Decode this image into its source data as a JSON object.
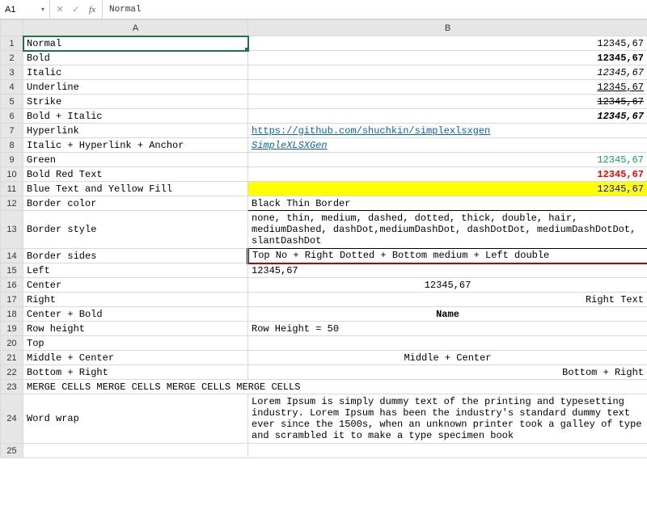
{
  "formula_bar": {
    "name_box": "A1",
    "formula_value": "Normal"
  },
  "col_headers": {
    "A": "A",
    "B": "B"
  },
  "rows": {
    "r1": {
      "a": "Normal",
      "b": "12345,67"
    },
    "r2": {
      "a": "Bold",
      "b": "12345,67"
    },
    "r3": {
      "a": "Italic",
      "b": "12345,67"
    },
    "r4": {
      "a": "Underline",
      "b": "12345,67"
    },
    "r5": {
      "a": "Strike",
      "b": "12345,67"
    },
    "r6": {
      "a": "Bold + Italic",
      "b": "12345,67"
    },
    "r7": {
      "a": "Hyperlink",
      "b": "https://github.com/shuchkin/simplexlsxgen"
    },
    "r8": {
      "a": "Italic + Hyperlink + Anchor",
      "b": "SimpleXLSXGen"
    },
    "r9": {
      "a": "Green",
      "b": "12345,67"
    },
    "r10": {
      "a": "Bold Red Text",
      "b": "12345,67"
    },
    "r11": {
      "a": "Blue Text and Yellow Fill",
      "b": "12345,67"
    },
    "r12": {
      "a": "Border color",
      "b": "Black Thin Border"
    },
    "r13": {
      "a": "Border style",
      "b": "none, thin, medium, dashed, dotted, thick, double, hair, mediumDashed, dashDot,mediumDashDot, dashDotDot, mediumDashDotDot, slantDashDot"
    },
    "r14": {
      "a": "Border sides",
      "b": "Top No + Right Dotted + Bottom medium + Left double"
    },
    "r15": {
      "a": "Left",
      "b": "12345,67"
    },
    "r16": {
      "a": "Center",
      "b": "12345,67"
    },
    "r17": {
      "a": "Right",
      "b": "Right Text"
    },
    "r18": {
      "a": "Center + Bold",
      "b": "Name"
    },
    "r19": {
      "a": "Row height",
      "b": "Row Height = 50"
    },
    "r20": {
      "a": "Top",
      "b": ""
    },
    "r21": {
      "a": "Middle + Center",
      "b": "Middle + Center"
    },
    "r22": {
      "a": "Bottom + Right",
      "b": "Bottom + Right"
    },
    "r23": {
      "ab": "MERGE CELLS MERGE CELLS MERGE CELLS MERGE CELLS"
    },
    "r24": {
      "a": "Word wrap",
      "b": "Lorem Ipsum is simply dummy text of the printing and typesetting industry. Lorem Ipsum has been the industry's standard dummy text ever since the 1500s, when an unknown printer took a galley of type and scrambled it to make a type specimen book"
    },
    "r25": {
      "a": "",
      "b": ""
    }
  },
  "row_labels": {
    "r1": "1",
    "r2": "2",
    "r3": "3",
    "r4": "4",
    "r5": "5",
    "r6": "6",
    "r7": "7",
    "r8": "8",
    "r9": "9",
    "r10": "10",
    "r11": "11",
    "r12": "12",
    "r13": "13",
    "r14": "14",
    "r15": "15",
    "r16": "16",
    "r17": "17",
    "r18": "18",
    "r19": "19",
    "r20": "20",
    "r21": "21",
    "r22": "22",
    "r23": "23",
    "r24": "24",
    "r25": "25"
  }
}
